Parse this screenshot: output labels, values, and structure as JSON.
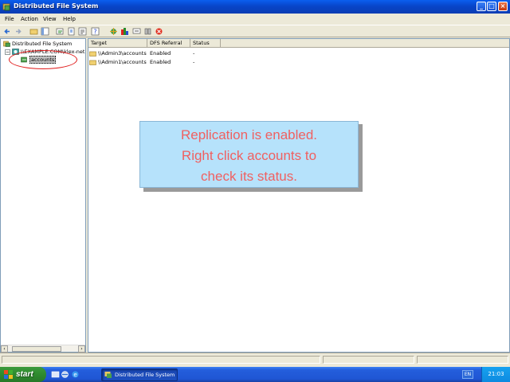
{
  "window": {
    "title": "Distributed File System",
    "controls": [
      "minimize",
      "maximize",
      "close"
    ]
  },
  "menu": {
    "items": [
      "File",
      "Action",
      "View",
      "Help"
    ]
  },
  "toolbar": {
    "icons": [
      "back-icon",
      "forward-icon",
      "up-folder-icon",
      "show-hide-tree-icon",
      "refresh-icon",
      "export-list-icon",
      "properties-icon",
      "help-icon",
      "new-root-icon",
      "new-link-icon",
      "display-icon",
      "filter-icon",
      "delete-icon"
    ]
  },
  "tree": {
    "root": "Distributed File System",
    "child": "\\\\EXAMPLE.COM\\klex-net",
    "selected": "accounts"
  },
  "list": {
    "columns": [
      "Target",
      "DFS Referral",
      "Status"
    ],
    "rows": [
      {
        "target": "\\\\Admin3\\accounts",
        "referral": "Enabled",
        "status": "-"
      },
      {
        "target": "\\\\Admin1\\accounts",
        "referral": "Enabled",
        "status": "-"
      }
    ]
  },
  "callout": {
    "lines": [
      "Replication is enabled.",
      "Right click accounts to",
      "check its status."
    ]
  },
  "taskbar": {
    "start_label": "start",
    "task_label": "Distributed File System",
    "language": "EN",
    "clock": "21:03"
  },
  "colors": {
    "titlebar": "#0845c9",
    "callout_bg": "#b6e2fb",
    "callout_text": "#f06060",
    "annotation_ring": "#e01818"
  }
}
